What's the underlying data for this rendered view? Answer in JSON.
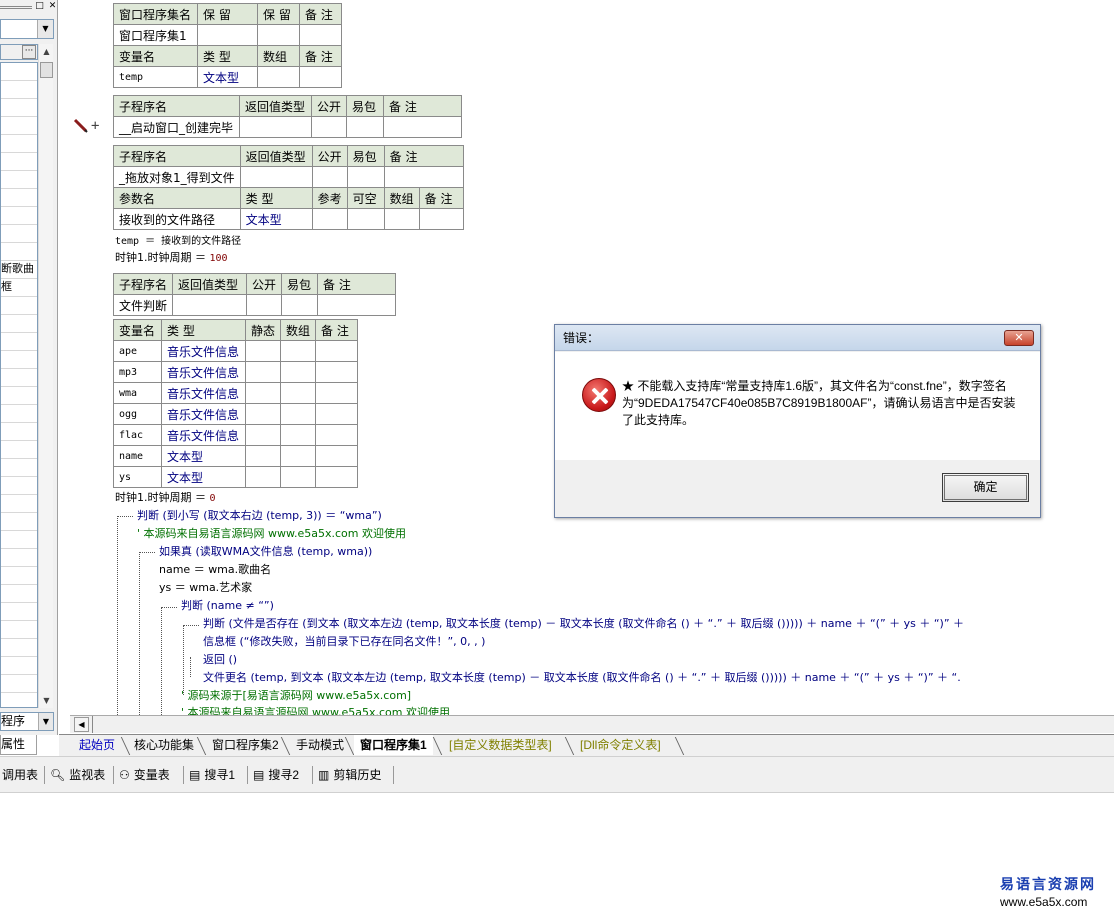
{
  "left_panel": {
    "rows": [
      "",
      "",
      "",
      "",
      "",
      "",
      "",
      "",
      "",
      "",
      "",
      "断歌曲",
      "框",
      "",
      "",
      "",
      "",
      "",
      "",
      "",
      "",
      "",
      "",
      "",
      "",
      "",
      "",
      "",
      "",
      "",
      "",
      "",
      "",
      "",
      "",
      "",
      ""
    ],
    "bottom_combo": "程序",
    "properties_tab": "属性",
    "dots": "···"
  },
  "tables": {
    "window_set": {
      "headers": [
        "窗口程序集名",
        "保 留",
        "保 留",
        "备 注"
      ],
      "row": [
        "窗口程序集1",
        "",
        "",
        ""
      ],
      "var_headers": [
        "变量名",
        "类 型",
        "数组",
        "备 注"
      ],
      "var_row": [
        "temp",
        "文本型",
        "",
        ""
      ]
    },
    "sub1": {
      "headers": [
        "子程序名",
        "返回值类型",
        "公开",
        "易包",
        "备 注"
      ],
      "row": [
        "__启动窗口_创建完毕",
        "",
        "",
        "",
        ""
      ]
    },
    "sub2": {
      "headers": [
        "子程序名",
        "返回值类型",
        "公开",
        "易包",
        "备 注"
      ],
      "row": [
        "_拖放对象1_得到文件",
        "",
        "",
        "",
        ""
      ],
      "param_headers": [
        "参数名",
        "类 型",
        "参考",
        "可空",
        "数组",
        "备 注"
      ],
      "param_row": [
        "接收到的文件路径",
        "文本型",
        "",
        "",
        "",
        ""
      ]
    },
    "sub3": {
      "headers": [
        "子程序名",
        "返回值类型",
        "公开",
        "易包",
        "备 注"
      ],
      "row": [
        "文件判断",
        "",
        "",
        "",
        ""
      ]
    },
    "locals": {
      "headers": [
        "变量名",
        "类 型",
        "静态",
        "数组",
        "备 注"
      ],
      "rows": [
        [
          "ape",
          "音乐文件信息"
        ],
        [
          "mp3",
          "音乐文件信息"
        ],
        [
          "wma",
          "音乐文件信息"
        ],
        [
          "ogg",
          "音乐文件信息"
        ],
        [
          "flac",
          "音乐文件信息"
        ],
        [
          "name",
          "文本型"
        ],
        [
          "ys",
          "文本型"
        ]
      ]
    }
  },
  "code": {
    "l1": "temp ＝ 接收到的文件路径",
    "l2a": "时钟1.时钟周期 ＝ ",
    "l2b": "100",
    "l3a": "时钟1.时钟周期 ＝ ",
    "l3b": "0",
    "l4": "判断 (到小写 (取文本右边 (temp, 3)) ＝ “wma”)",
    "l5": "' 本源码来自易语言源码网 www.e5a5x.com  欢迎使用",
    "l6": "如果真 (读取WMA文件信息 (temp, wma))",
    "l7": "name ＝ wma.歌曲名",
    "l8": "ys ＝ wma.艺术家",
    "l9": "判断 (name ≠ “”)",
    "l10": "判断 (文件是否存在 (到文本 (取文本左边 (temp, 取文本长度 (temp) － 取文本长度 (取文件命名 () ＋ “.” ＋ 取后缀 ())))) ＋ name ＋ “(” ＋ ys ＋ “)” ＋",
    "l11": "信息框 (“修改失败，当前目录下已存在同名文件！”, 0, , )",
    "l12": "返回 ()",
    "l13": "文件更名 (temp, 到文本 (取文本左边 (temp, 取文本长度 (temp) － 取文本长度 (取文件命名 () ＋ “.” ＋ 取后缀 ())))) ＋ name ＋ “(” ＋ ys ＋ “)” ＋ “.",
    "l14": "' 源码来源于[易语言源码网 www.e5a5x.com]",
    "l15": "' 本源码来自易语言源码网 www.e5a5x.com  欢迎使用"
  },
  "tabs": [
    "起始页",
    "核心功能集",
    "窗口程序集2",
    "手动模式",
    "窗口程序集1",
    "[自定义数据类型表]",
    "[Dll命令定义表]"
  ],
  "toolbar": [
    {
      "icon": "call-table-icon",
      "label": "调用表"
    },
    {
      "icon": "magnifier-icon",
      "label": "监视表"
    },
    {
      "icon": "variables-icon",
      "label": "变量表"
    },
    {
      "icon": "search-doc-icon",
      "label": "搜寻1"
    },
    {
      "icon": "search-doc-icon",
      "label": "搜寻2"
    },
    {
      "icon": "clipboard-icon",
      "label": "剪辑历史"
    }
  ],
  "dialog": {
    "title": "错误：",
    "message": "★ 不能载入支持库“常量支持库1.6版”，其文件名为“const.fne”，数字签名为“9DEDA17547CF40e085B7C8919B1800AF”，请确认易语言中是否安装了此支持库。",
    "ok": "确定"
  },
  "watermark": {
    "title": "易语言资源网",
    "url": "www.e5a5x.com"
  }
}
